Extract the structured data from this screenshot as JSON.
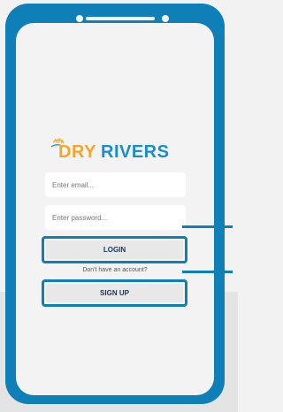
{
  "app": {
    "logo_text": "DRYRIVERS",
    "brand_color": "#0e7fb7",
    "logo_colors": {
      "dry": "#f4a62a",
      "rivers": "#1a8ec9"
    }
  },
  "form": {
    "email_placeholder": "Enter email...",
    "password_placeholder": "Enter password...",
    "login_label": "LOGIN",
    "no_account_text": "Don't have an account?",
    "signup_label": "SIGN UP"
  }
}
